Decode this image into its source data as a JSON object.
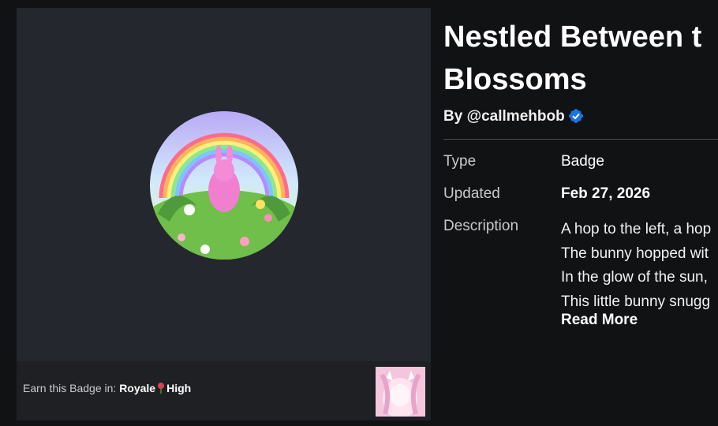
{
  "left_panel": {
    "earn_prefix": "Earn this Badge in:",
    "game_name_part1": "Royale",
    "game_name_part2": "High"
  },
  "details": {
    "title_line1": "Nestled Between t",
    "title_line2": "Blossoms",
    "by_label": "By",
    "creator": "@callmehbob",
    "rows": [
      {
        "label": "Type",
        "value": "Badge"
      },
      {
        "label": "Updated",
        "value": "Feb 27, 2026"
      },
      {
        "label": "Description"
      }
    ],
    "description_lines": [
      "A hop to the left, a hop",
      "The bunny hopped wit",
      "In the glow of the sun,",
      "This little bunny snugg"
    ],
    "read_more": "Read More"
  },
  "colors": {
    "page_bg": "#111214",
    "panel_bg": "#25272e",
    "verified_blue": "#1a73e8"
  }
}
